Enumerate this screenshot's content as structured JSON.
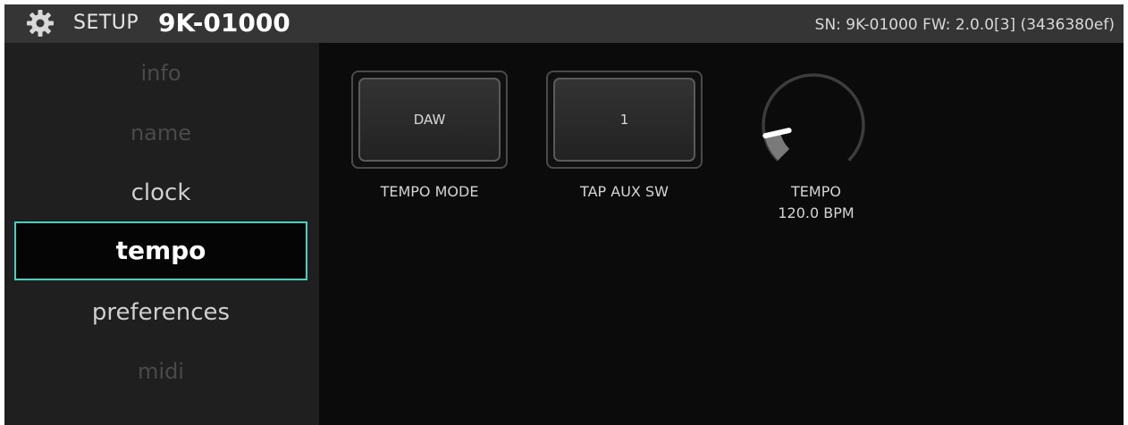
{
  "header": {
    "title_prefix": "SETUP",
    "device_name": "9K-01000",
    "device_info": "SN: 9K-01000 FW: 2.0.0[3] (3436380ef)"
  },
  "sidebar": {
    "items": [
      {
        "label": "info",
        "state": "dim"
      },
      {
        "label": "name",
        "state": "dim"
      },
      {
        "label": "clock",
        "state": "normal"
      },
      {
        "label": "tempo",
        "state": "active"
      },
      {
        "label": "preferences",
        "state": "normal"
      },
      {
        "label": "midi",
        "state": "dim"
      }
    ]
  },
  "controls": {
    "tempo_mode": {
      "value": "DAW",
      "caption": "TEMPO MODE"
    },
    "tap_aux_sw": {
      "value": "1",
      "caption": "TAP AUX SW"
    },
    "tempo": {
      "caption": "TEMPO",
      "value": "120.0 BPM",
      "level": 0.12
    }
  },
  "colors": {
    "accent": "#40d4c0",
    "header_bg": "#353535",
    "sidebar_bg": "#1f1f1f",
    "content_bg": "#0b0b0b",
    "knob_fill": "#7a7a7a"
  }
}
